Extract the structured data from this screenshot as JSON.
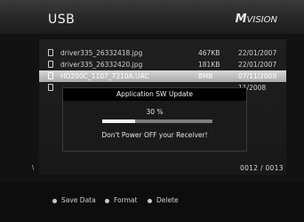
{
  "header": {
    "title": "USB",
    "logo_prefix": "M",
    "logo_text": "VISION"
  },
  "files": [
    {
      "name": "driver335_26332418.jpg",
      "size": "467KB",
      "date": "22/01/2007",
      "selected": false
    },
    {
      "name": "driver335_26332420.jpg",
      "size": "181KB",
      "date": "22/01/2007",
      "selected": false
    },
    {
      "name": "HD200C_1107_7210A.UAC",
      "size": "8MB",
      "date": "07/11/2008",
      "selected": true
    },
    {
      "name": "",
      "size": "",
      "date": "11/2008",
      "selected": false
    }
  ],
  "dialog": {
    "title": "Application SW Update",
    "percent_text": "30 %",
    "progress": 0.3,
    "warning": "Don't Power OFF your Receiver!"
  },
  "list_indicator": "\\",
  "counter": "0012 / 0013",
  "footer": {
    "items": [
      {
        "label": "Save Data",
        "color": "#c8c8c8"
      },
      {
        "label": "Format",
        "color": "#c8c8c8"
      },
      {
        "label": "Delete",
        "color": "#c8c8c8"
      }
    ]
  }
}
